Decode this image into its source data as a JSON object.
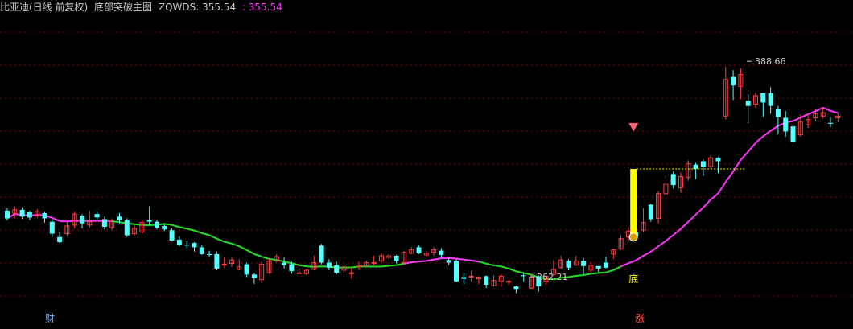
{
  "header": {
    "stock_name": "比亚迪(日线 前复权)",
    "indicator_name": "底部突破主图",
    "series_label": "ZQWDS: 355.54",
    "series_value": ": 355.54"
  },
  "colors": {
    "background": "#000000",
    "grid": "#8b0000",
    "up_candle": "#ff4040",
    "down_candle": "#54ffff",
    "ma_green": "#22dd22",
    "ma_magenta": "#ff33ff",
    "signal_bar": "#ffff00",
    "header_magenta": "#ff33ff"
  },
  "chart_data": {
    "type": "candlestick",
    "y_range": [
      240,
      410
    ],
    "high_label": "388.66",
    "low_label": "262.21",
    "bottom_signal_label": "底",
    "footer_left_label": "财",
    "footer_right_label": "涨",
    "candles": [
      [
        300.5,
        296.0,
        302.0,
        294.8
      ],
      [
        298.9,
        301.0,
        303.0,
        296.0
      ],
      [
        301.0,
        297.0,
        302.5,
        295.5
      ],
      [
        299.5,
        296.5,
        300.5,
        295.0
      ],
      [
        297.5,
        300.0,
        301.5,
        296.5
      ],
      [
        299.0,
        296.0,
        300.0,
        293.5
      ],
      [
        294.0,
        287.0,
        295.5,
        285.0
      ],
      [
        285.0,
        282.0,
        288.0,
        281.5
      ],
      [
        287.0,
        291.5,
        294.0,
        285.5
      ],
      [
        292.0,
        298.5,
        300.0,
        290.0
      ],
      [
        297.5,
        293.0,
        298.5,
        290.0
      ],
      [
        292.0,
        294.0,
        300.5,
        290.5
      ],
      [
        298.5,
        296.5,
        300.0,
        295.0
      ],
      [
        295.5,
        291.0,
        297.0,
        289.5
      ],
      [
        290.5,
        295.0,
        296.0,
        289.0
      ],
      [
        297.0,
        295.0,
        299.0,
        293.0
      ],
      [
        295.0,
        286.0,
        296.0,
        285.0
      ],
      [
        287.0,
        290.0,
        293.0,
        285.5
      ],
      [
        288.0,
        293.5,
        295.0,
        287.0
      ],
      [
        295.0,
        294.0,
        303.0,
        292.0
      ],
      [
        294.0,
        290.5,
        295.0,
        289.5
      ],
      [
        291.5,
        289.5,
        293.0,
        288.5
      ],
      [
        289.0,
        283.0,
        290.0,
        282.5
      ],
      [
        283.5,
        280.5,
        285.5,
        279.5
      ],
      [
        280.5,
        280.0,
        283.0,
        278.5
      ],
      [
        281.5,
        279.0,
        282.0,
        276.5
      ],
      [
        279.0,
        275.0,
        280.5,
        274.5
      ],
      [
        275.0,
        274.5,
        277.0,
        273.5
      ],
      [
        275.0,
        266.5,
        276.5,
        265.5
      ],
      [
        268.5,
        269.0,
        273.0,
        267.0
      ],
      [
        269.5,
        271.5,
        273.0,
        267.5
      ],
      [
        266.0,
        267.5,
        272.0,
        265.5
      ],
      [
        269.0,
        263.0,
        270.0,
        261.5
      ],
      [
        263.0,
        261.0,
        264.0,
        257.5
      ],
      [
        260.0,
        269.0,
        270.5,
        258.0
      ],
      [
        264.0,
        271.0,
        272.5,
        263.5
      ],
      [
        271.0,
        273.5,
        275.0,
        270.0
      ],
      [
        270.0,
        268.5,
        273.0,
        266.5
      ],
      [
        269.0,
        265.0,
        270.5,
        263.5
      ],
      [
        264.0,
        264.0,
        266.5,
        263.0
      ],
      [
        263.5,
        265.5,
        266.5,
        262.5
      ],
      [
        266.0,
        270.0,
        274.0,
        265.5
      ],
      [
        280.0,
        270.0,
        281.0,
        269.0
      ],
      [
        270.0,
        267.0,
        272.0,
        265.5
      ],
      [
        268.5,
        264.0,
        270.5,
        263.0
      ],
      [
        265.5,
        267.5,
        268.5,
        264.0
      ],
      [
        264.0,
        264.0,
        267.0,
        260.5
      ],
      [
        267.5,
        268.0,
        270.5,
        265.5
      ],
      [
        268.0,
        270.0,
        271.0,
        267.0
      ],
      [
        270.0,
        270.0,
        274.0,
        268.5
      ],
      [
        271.0,
        274.0,
        275.5,
        270.0
      ],
      [
        273.0,
        274.0,
        275.0,
        271.5
      ],
      [
        274.0,
        271.0,
        274.5,
        269.5
      ],
      [
        270.0,
        276.0,
        277.0,
        269.5
      ],
      [
        275.5,
        277.5,
        279.0,
        275.0
      ],
      [
        279.0,
        275.5,
        280.0,
        275.0
      ],
      [
        274.5,
        275.5,
        277.0,
        273.0
      ],
      [
        276.0,
        277.5,
        279.0,
        274.0
      ],
      [
        277.0,
        274.5,
        278.5,
        273.0
      ],
      [
        271.5,
        270.0,
        273.0,
        268.5
      ],
      [
        271.0,
        259.0,
        272.0,
        258.5
      ],
      [
        261.5,
        260.5,
        264.0,
        257.5
      ],
      [
        262.0,
        262.0,
        265.0,
        259.0
      ],
      [
        260.5,
        261.5,
        262.0,
        257.5
      ],
      [
        262.0,
        257.0,
        262.5,
        255.0
      ],
      [
        256.5,
        259.5,
        262.5,
        256.0
      ],
      [
        259.0,
        262.0,
        263.0,
        255.5
      ],
      [
        259.0,
        259.0,
        260.0,
        257.0
      ],
      [
        256.0,
        254.5,
        256.5,
        252.0
      ],
      [
        262.5,
        262.0,
        264.0,
        259.0
      ],
      [
        255.0,
        261.5,
        263.5,
        254.5
      ],
      [
        262.0,
        256.0,
        262.5,
        253.0
      ],
      [
        259.0,
        262.0,
        262.0,
        257.0
      ],
      [
        263.0,
        266.0,
        271.5,
        262.0
      ],
      [
        267.0,
        271.5,
        274.0,
        266.5
      ],
      [
        271.0,
        267.0,
        272.0,
        265.5
      ],
      [
        268.5,
        271.0,
        274.0,
        268.5
      ],
      [
        271.0,
        268.0,
        272.5,
        263.0
      ],
      [
        265.5,
        268.0,
        270.0,
        264.0
      ],
      [
        268.0,
        266.5,
        268.0,
        264.5
      ],
      [
        270.0,
        267.0,
        273.5,
        266.5
      ],
      [
        275.0,
        277.5,
        278.0,
        272.0
      ],
      [
        278.0,
        284.0,
        286.0,
        277.5
      ],
      [
        285.0,
        288.5,
        291.0,
        283.0
      ],
      [
        288.0,
        285.5,
        289.0,
        283.0
      ],
      [
        289.0,
        293.5,
        302.0,
        288.0
      ],
      [
        304.0,
        295.5,
        304.5,
        294.0
      ],
      [
        296.0,
        310.5,
        312.0,
        293.0
      ],
      [
        310.5,
        316.0,
        321.5,
        309.5
      ],
      [
        322.0,
        315.5,
        323.5,
        313.5
      ],
      [
        314.0,
        320.5,
        323.0,
        311.0
      ],
      [
        320.0,
        328.0,
        330.0,
        318.0
      ],
      [
        327.5,
        325.0,
        328.5,
        319.0
      ],
      [
        329.5,
        326.0,
        330.5,
        321.0
      ],
      [
        326.5,
        331.5,
        333.0,
        325.0
      ],
      [
        331.5,
        329.5,
        332.0,
        322.5
      ],
      [
        356.0,
        377.5,
        385.0,
        354.0
      ],
      [
        379.0,
        374.0,
        383.0,
        365.5
      ],
      [
        373.5,
        380.5,
        384.0,
        366.0
      ],
      [
        365.0,
        362.0,
        369.0,
        352.0
      ],
      [
        363.0,
        368.0,
        370.0,
        361.0
      ],
      [
        369.5,
        364.0,
        369.5,
        355.5
      ],
      [
        369.5,
        362.0,
        373.0,
        357.5
      ],
      [
        360.0,
        355.5,
        362.0,
        345.5
      ],
      [
        355.0,
        347.0,
        359.0,
        344.0
      ],
      [
        350.0,
        341.0,
        354.0,
        338.0
      ],
      [
        345.0,
        352.5,
        357.0,
        344.0
      ],
      [
        351.0,
        354.0,
        357.0,
        349.0
      ],
      [
        355.0,
        357.5,
        360.0,
        353.0
      ],
      [
        356.0,
        358.0,
        361.0,
        354.5
      ],
      [
        352.0,
        351.5,
        355.5,
        349.5
      ],
      [
        355.0,
        356.0,
        357.5,
        352.5
      ]
    ]
  }
}
